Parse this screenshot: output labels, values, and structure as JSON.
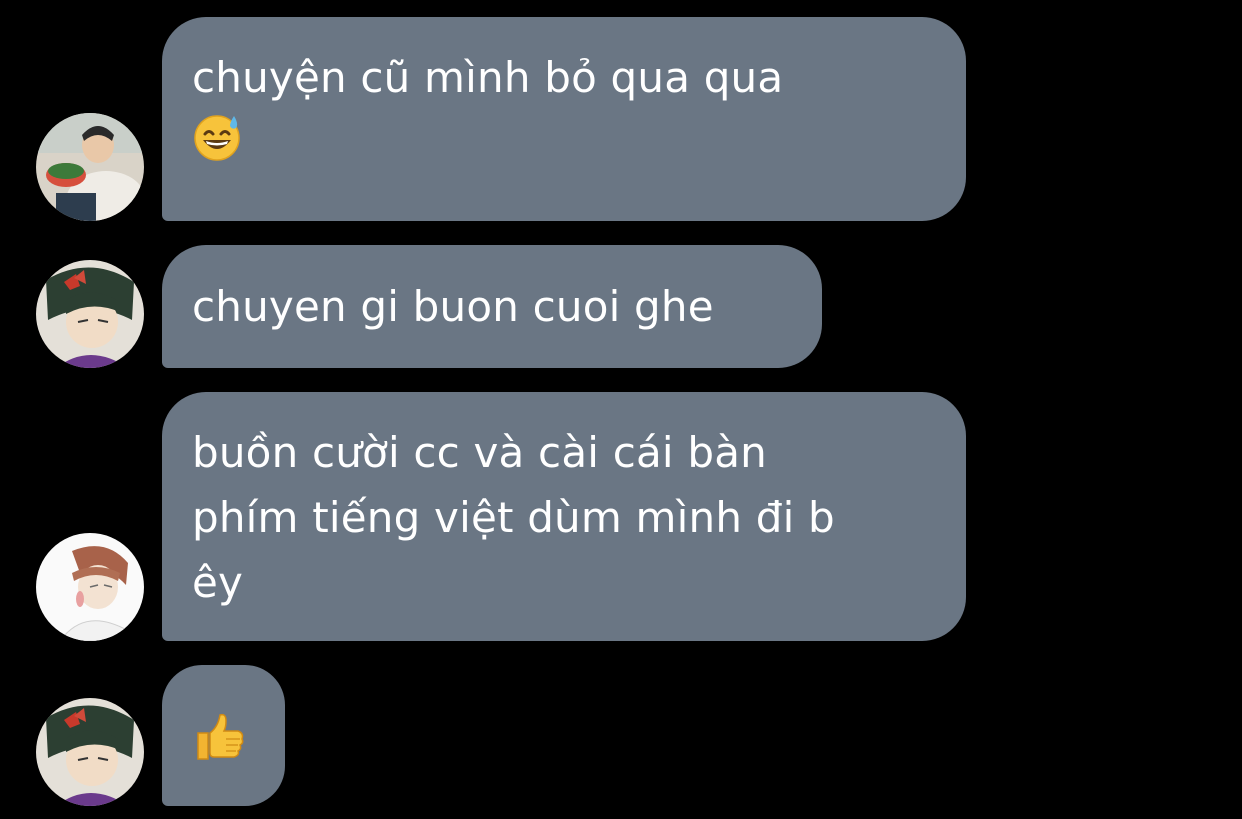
{
  "messages": [
    {
      "text": "chuyện cũ mình bỏ qua qua",
      "emoji": "grinning-sweat-emoji"
    },
    {
      "text": "chuyen gi buon cuoi ghe"
    },
    {
      "text": "buồn cười cc và cài cái bàn\nphím tiếng việt dùm mình đi b\nêy"
    },
    {
      "emoji": "thumbs-up-emoji"
    }
  ],
  "colors": {
    "background": "#000000",
    "bubble": "#6a7684",
    "text": "#ffffff"
  }
}
